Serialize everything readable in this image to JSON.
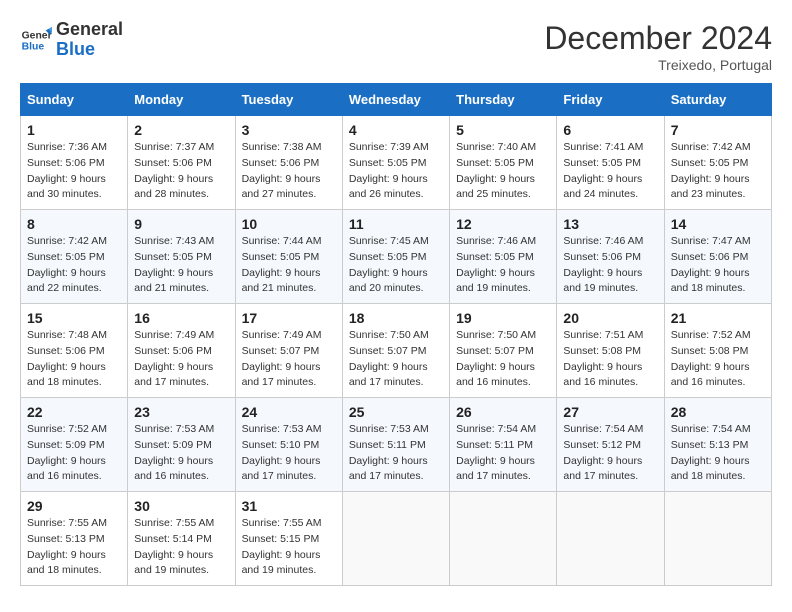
{
  "header": {
    "logo_line1": "General",
    "logo_line2": "Blue",
    "month": "December 2024",
    "location": "Treixedo, Portugal"
  },
  "days_of_week": [
    "Sunday",
    "Monday",
    "Tuesday",
    "Wednesday",
    "Thursday",
    "Friday",
    "Saturday"
  ],
  "weeks": [
    [
      {
        "day": "1",
        "sunrise": "Sunrise: 7:36 AM",
        "sunset": "Sunset: 5:06 PM",
        "daylight": "Daylight: 9 hours and 30 minutes."
      },
      {
        "day": "2",
        "sunrise": "Sunrise: 7:37 AM",
        "sunset": "Sunset: 5:06 PM",
        "daylight": "Daylight: 9 hours and 28 minutes."
      },
      {
        "day": "3",
        "sunrise": "Sunrise: 7:38 AM",
        "sunset": "Sunset: 5:06 PM",
        "daylight": "Daylight: 9 hours and 27 minutes."
      },
      {
        "day": "4",
        "sunrise": "Sunrise: 7:39 AM",
        "sunset": "Sunset: 5:05 PM",
        "daylight": "Daylight: 9 hours and 26 minutes."
      },
      {
        "day": "5",
        "sunrise": "Sunrise: 7:40 AM",
        "sunset": "Sunset: 5:05 PM",
        "daylight": "Daylight: 9 hours and 25 minutes."
      },
      {
        "day": "6",
        "sunrise": "Sunrise: 7:41 AM",
        "sunset": "Sunset: 5:05 PM",
        "daylight": "Daylight: 9 hours and 24 minutes."
      },
      {
        "day": "7",
        "sunrise": "Sunrise: 7:42 AM",
        "sunset": "Sunset: 5:05 PM",
        "daylight": "Daylight: 9 hours and 23 minutes."
      }
    ],
    [
      {
        "day": "8",
        "sunrise": "Sunrise: 7:42 AM",
        "sunset": "Sunset: 5:05 PM",
        "daylight": "Daylight: 9 hours and 22 minutes."
      },
      {
        "day": "9",
        "sunrise": "Sunrise: 7:43 AM",
        "sunset": "Sunset: 5:05 PM",
        "daylight": "Daylight: 9 hours and 21 minutes."
      },
      {
        "day": "10",
        "sunrise": "Sunrise: 7:44 AM",
        "sunset": "Sunset: 5:05 PM",
        "daylight": "Daylight: 9 hours and 21 minutes."
      },
      {
        "day": "11",
        "sunrise": "Sunrise: 7:45 AM",
        "sunset": "Sunset: 5:05 PM",
        "daylight": "Daylight: 9 hours and 20 minutes."
      },
      {
        "day": "12",
        "sunrise": "Sunrise: 7:46 AM",
        "sunset": "Sunset: 5:05 PM",
        "daylight": "Daylight: 9 hours and 19 minutes."
      },
      {
        "day": "13",
        "sunrise": "Sunrise: 7:46 AM",
        "sunset": "Sunset: 5:06 PM",
        "daylight": "Daylight: 9 hours and 19 minutes."
      },
      {
        "day": "14",
        "sunrise": "Sunrise: 7:47 AM",
        "sunset": "Sunset: 5:06 PM",
        "daylight": "Daylight: 9 hours and 18 minutes."
      }
    ],
    [
      {
        "day": "15",
        "sunrise": "Sunrise: 7:48 AM",
        "sunset": "Sunset: 5:06 PM",
        "daylight": "Daylight: 9 hours and 18 minutes."
      },
      {
        "day": "16",
        "sunrise": "Sunrise: 7:49 AM",
        "sunset": "Sunset: 5:06 PM",
        "daylight": "Daylight: 9 hours and 17 minutes."
      },
      {
        "day": "17",
        "sunrise": "Sunrise: 7:49 AM",
        "sunset": "Sunset: 5:07 PM",
        "daylight": "Daylight: 9 hours and 17 minutes."
      },
      {
        "day": "18",
        "sunrise": "Sunrise: 7:50 AM",
        "sunset": "Sunset: 5:07 PM",
        "daylight": "Daylight: 9 hours and 17 minutes."
      },
      {
        "day": "19",
        "sunrise": "Sunrise: 7:50 AM",
        "sunset": "Sunset: 5:07 PM",
        "daylight": "Daylight: 9 hours and 16 minutes."
      },
      {
        "day": "20",
        "sunrise": "Sunrise: 7:51 AM",
        "sunset": "Sunset: 5:08 PM",
        "daylight": "Daylight: 9 hours and 16 minutes."
      },
      {
        "day": "21",
        "sunrise": "Sunrise: 7:52 AM",
        "sunset": "Sunset: 5:08 PM",
        "daylight": "Daylight: 9 hours and 16 minutes."
      }
    ],
    [
      {
        "day": "22",
        "sunrise": "Sunrise: 7:52 AM",
        "sunset": "Sunset: 5:09 PM",
        "daylight": "Daylight: 9 hours and 16 minutes."
      },
      {
        "day": "23",
        "sunrise": "Sunrise: 7:53 AM",
        "sunset": "Sunset: 5:09 PM",
        "daylight": "Daylight: 9 hours and 16 minutes."
      },
      {
        "day": "24",
        "sunrise": "Sunrise: 7:53 AM",
        "sunset": "Sunset: 5:10 PM",
        "daylight": "Daylight: 9 hours and 17 minutes."
      },
      {
        "day": "25",
        "sunrise": "Sunrise: 7:53 AM",
        "sunset": "Sunset: 5:11 PM",
        "daylight": "Daylight: 9 hours and 17 minutes."
      },
      {
        "day": "26",
        "sunrise": "Sunrise: 7:54 AM",
        "sunset": "Sunset: 5:11 PM",
        "daylight": "Daylight: 9 hours and 17 minutes."
      },
      {
        "day": "27",
        "sunrise": "Sunrise: 7:54 AM",
        "sunset": "Sunset: 5:12 PM",
        "daylight": "Daylight: 9 hours and 17 minutes."
      },
      {
        "day": "28",
        "sunrise": "Sunrise: 7:54 AM",
        "sunset": "Sunset: 5:13 PM",
        "daylight": "Daylight: 9 hours and 18 minutes."
      }
    ],
    [
      {
        "day": "29",
        "sunrise": "Sunrise: 7:55 AM",
        "sunset": "Sunset: 5:13 PM",
        "daylight": "Daylight: 9 hours and 18 minutes."
      },
      {
        "day": "30",
        "sunrise": "Sunrise: 7:55 AM",
        "sunset": "Sunset: 5:14 PM",
        "daylight": "Daylight: 9 hours and 19 minutes."
      },
      {
        "day": "31",
        "sunrise": "Sunrise: 7:55 AM",
        "sunset": "Sunset: 5:15 PM",
        "daylight": "Daylight: 9 hours and 19 minutes."
      },
      null,
      null,
      null,
      null
    ]
  ]
}
